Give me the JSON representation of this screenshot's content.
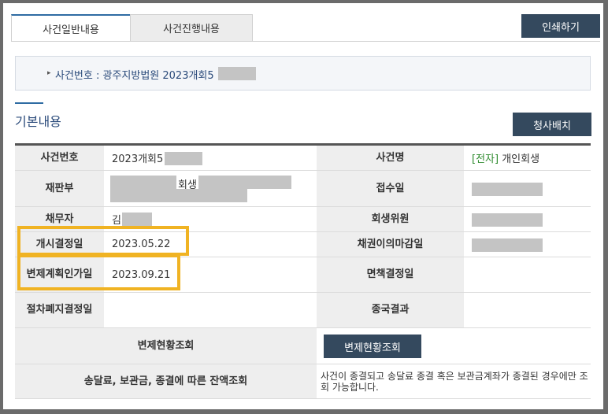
{
  "tabs": [
    {
      "label": "사건일반내용",
      "active": true
    },
    {
      "label": "사건진행내용",
      "active": false
    }
  ],
  "print_button": "인쇄하기",
  "case_number_line": "사건번호 : 광주지방법원 2023개회5",
  "section_title": "기본내용",
  "assign_button": "청사배치",
  "table": {
    "case_no_label": "사건번호",
    "case_no_value": "2023개회5",
    "case_name_label": "사건명",
    "case_name_tag": "[전자]",
    "case_name_value": " 개인회생",
    "court_label": "재판부",
    "court_value": "회생",
    "receipt_label": "접수일",
    "debtor_label": "채무자",
    "debtor_value": "김",
    "committee_label": "회생위원",
    "start_label": "개시결정일",
    "start_value": "2023.05.22",
    "claim_deadline_label": "채권이의마감일",
    "plan_label": "변제계획인가일",
    "plan_value": "2023.09.21",
    "discharge_label": "면책결정일",
    "abolish_label": "절차폐지결정일",
    "final_label": "종국결과",
    "payment_label": "변제현황조회",
    "payment_button": "변제현황조회",
    "balance_label": "송달료, 보관금, 종결에 따른 잔액조회",
    "balance_note": "사건이 종결되고 송달료 종결 혹은 보관금계좌가 종결된 경우에만 조회 가능합니다."
  },
  "colors": {
    "accent": "#34495e",
    "highlight": "#f0b323",
    "tag_green": "#2e8b2e"
  }
}
